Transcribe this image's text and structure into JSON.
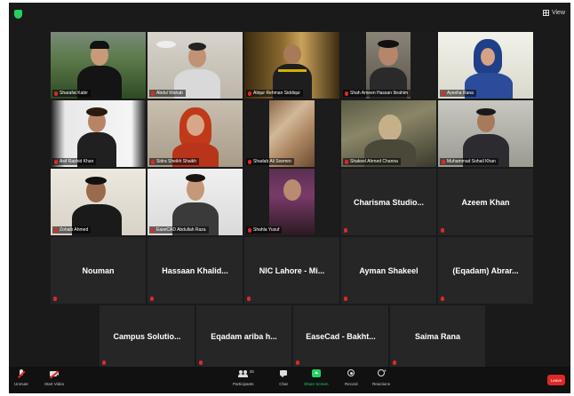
{
  "view_label": "View",
  "participants": [
    {
      "name": "Sharafat Kabir"
    },
    {
      "name": "Abdul Wahab"
    },
    {
      "name": "Atiqur Rehman Siddiqui"
    },
    {
      "name": "Shah Ameen Hassan Ibrahim"
    },
    {
      "name": "Ayesha Rana"
    },
    {
      "name": "Asif Rashid Khan"
    },
    {
      "name": "Sidra Sheikh Shaikh"
    },
    {
      "name": "Shadab Ali Soomro"
    },
    {
      "name": "Shakeel Ahmed Channa"
    },
    {
      "name": "Muhammad Sohail Khan"
    },
    {
      "name": "Zohaib Ahmed"
    },
    {
      "name": "EaseCAD Abdullah Raza"
    },
    {
      "name": "Shahla Yusuf"
    },
    {
      "name": "Charisma Studio..."
    },
    {
      "name": "Azeem Khan"
    },
    {
      "name": "Nouman"
    },
    {
      "name": "Hassaan Khalid..."
    },
    {
      "name": "NIC Lahore - Mi..."
    },
    {
      "name": "Ayman Shakeel"
    },
    {
      "name": "(Eqadam) Abrar..."
    },
    {
      "name": "Campus Solutio..."
    },
    {
      "name": "Eqadam ariba h..."
    },
    {
      "name": "EaseCad - Bakht..."
    },
    {
      "name": "Saima Rana"
    }
  ],
  "toolbar": {
    "unmute": "Unmute",
    "start_video": "Start Video",
    "participants": "Participants",
    "participants_count": "25",
    "chat": "Chat",
    "share_screen": "Share Screen",
    "record": "Record",
    "reactions": "Reactions",
    "leave": "Leave"
  },
  "colors": {
    "background": "#1a1a1a",
    "tile": "#262626",
    "active_speaker": "#b8e986",
    "share_screen": "#23d160",
    "leave": "#e02828"
  }
}
